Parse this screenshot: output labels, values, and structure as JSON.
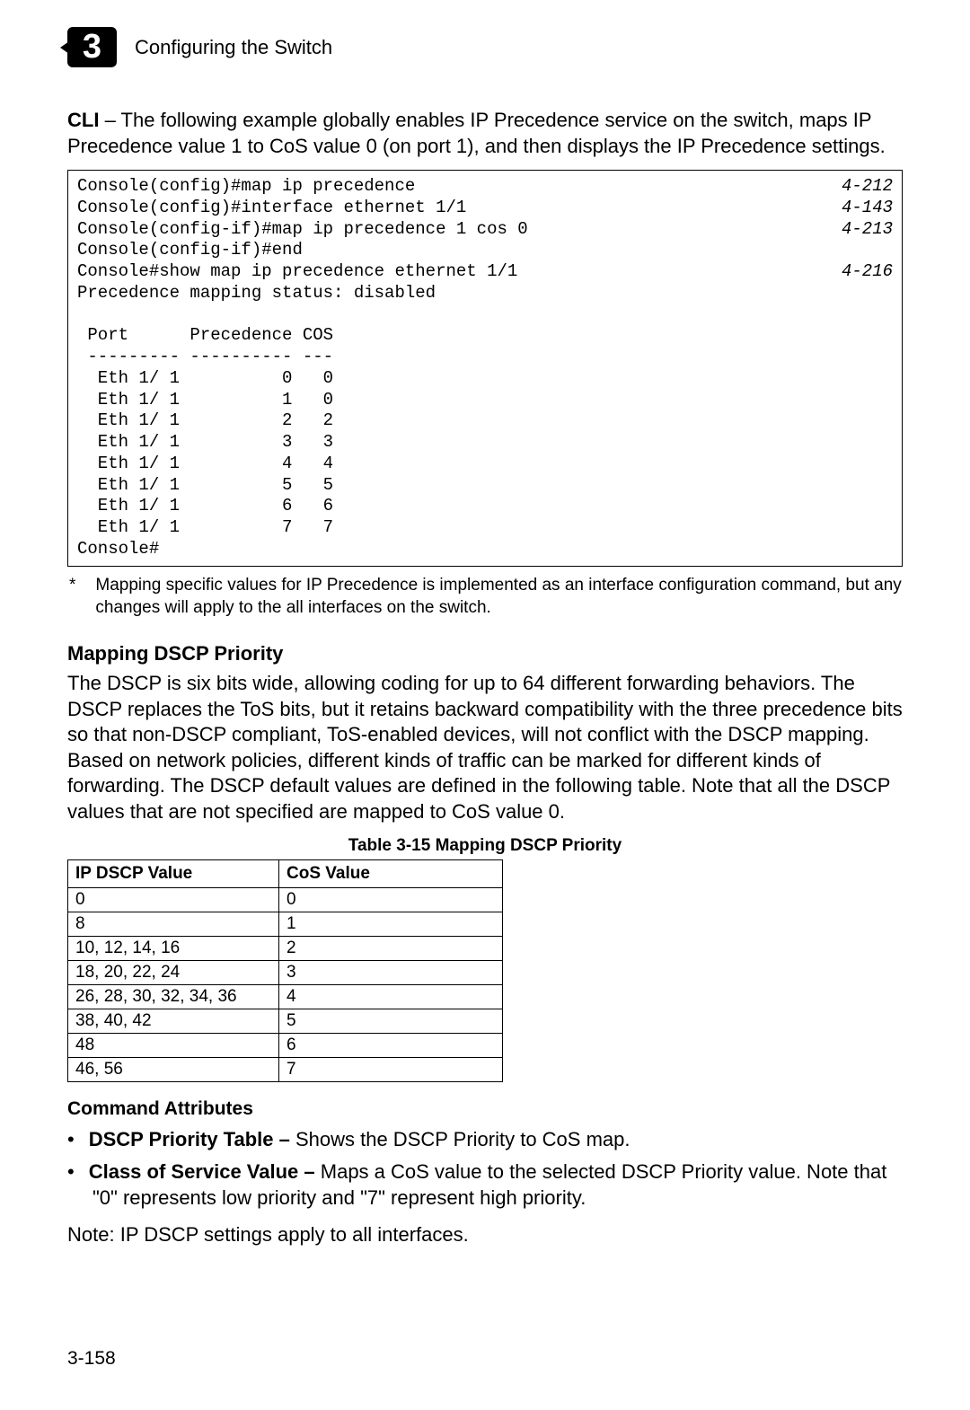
{
  "header": {
    "chapter_number": "3",
    "title": "Configuring the Switch"
  },
  "intro": {
    "cli_label": "CLI",
    "text_after": " – The following example globally enables IP Precedence service on the switch, maps IP Precedence value 1 to CoS value 0 (on port 1), and then displays the IP Precedence settings."
  },
  "console": {
    "lines": [
      {
        "cmd": "Console(config)#map ip precedence",
        "ref": "4-212"
      },
      {
        "cmd": "Console(config)#interface ethernet 1/1",
        "ref": "4-143"
      },
      {
        "cmd": "Console(config-if)#map ip precedence 1 cos 0",
        "ref": "4-213"
      },
      {
        "cmd": "Console(config-if)#end",
        "ref": ""
      },
      {
        "cmd": "Console#show map ip precedence ethernet 1/1",
        "ref": "4-216"
      },
      {
        "cmd": "Precedence mapping status: disabled",
        "ref": ""
      },
      {
        "cmd": "",
        "ref": ""
      },
      {
        "cmd": " Port      Precedence COS",
        "ref": ""
      },
      {
        "cmd": " --------- ---------- ---",
        "ref": ""
      },
      {
        "cmd": "  Eth 1/ 1          0   0",
        "ref": ""
      },
      {
        "cmd": "  Eth 1/ 1          1   0",
        "ref": ""
      },
      {
        "cmd": "  Eth 1/ 1          2   2",
        "ref": ""
      },
      {
        "cmd": "  Eth 1/ 1          3   3",
        "ref": ""
      },
      {
        "cmd": "  Eth 1/ 1          4   4",
        "ref": ""
      },
      {
        "cmd": "  Eth 1/ 1          5   5",
        "ref": ""
      },
      {
        "cmd": "  Eth 1/ 1          6   6",
        "ref": ""
      },
      {
        "cmd": "  Eth 1/ 1          7   7",
        "ref": ""
      },
      {
        "cmd": "Console#",
        "ref": ""
      }
    ]
  },
  "footnote": {
    "mark": "*",
    "text": "Mapping specific values for IP Precedence is implemented as an interface configuration command, but any changes will apply to the all interfaces on the switch."
  },
  "section": {
    "heading": "Mapping DSCP Priority",
    "paragraph": "The DSCP is six bits wide, allowing coding for up to 64 different forwarding behaviors. The DSCP replaces the ToS bits, but it retains backward compatibility with the three precedence bits so that non-DSCP compliant, ToS-enabled devices, will not conflict with the DSCP mapping. Based on network policies, different kinds of traffic can be marked for different kinds of forwarding. The DSCP default values are defined in the following table. Note that all the DSCP values that are not specified are mapped to CoS value 0."
  },
  "table": {
    "caption": "Table 3-15   Mapping DSCP Priority",
    "headers": [
      "IP DSCP Value",
      "CoS Value"
    ],
    "rows": [
      [
        "0",
        "0"
      ],
      [
        "8",
        "1"
      ],
      [
        "10, 12, 14, 16",
        "2"
      ],
      [
        "18, 20, 22, 24",
        "3"
      ],
      [
        "26, 28, 30, 32, 34, 36",
        "4"
      ],
      [
        "38, 40, 42",
        "5"
      ],
      [
        "48",
        "6"
      ],
      [
        "46, 56",
        "7"
      ]
    ]
  },
  "command_attributes": {
    "heading": "Command Attributes",
    "items": [
      {
        "bold": "DSCP Priority Table –",
        "rest": " Shows the DSCP Priority to CoS map."
      },
      {
        "bold": "Class of Service Value –",
        "rest": " Maps a CoS value to the selected DSCP Priority value. Note that \"0\" represents low priority and \"7\" represent high priority."
      }
    ]
  },
  "note": {
    "label": "Note:",
    "text": "  IP DSCP settings apply to all interfaces."
  },
  "page_number": "3-158"
}
